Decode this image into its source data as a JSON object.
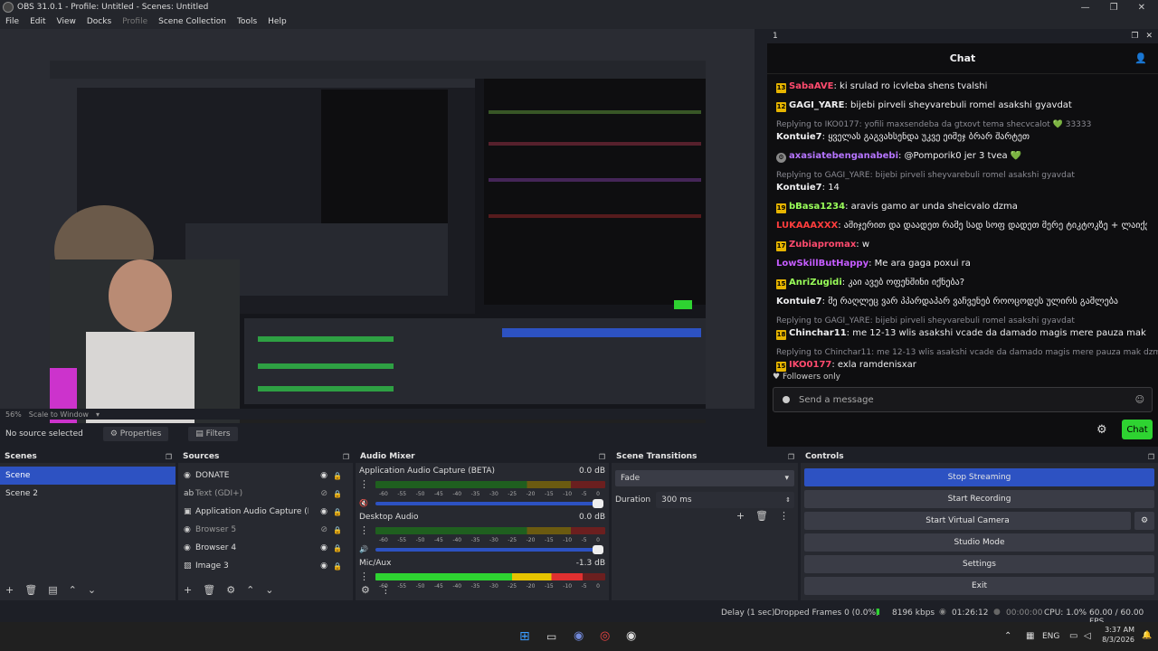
{
  "window": {
    "title": "OBS 31.0.1 - Profile: Untitled - Scenes: Untitled",
    "min": "—",
    "max": "❐",
    "close": "✕"
  },
  "menu": [
    "File",
    "Edit",
    "View",
    "Docks",
    "Profile",
    "Scene Collection",
    "Tools",
    "Help"
  ],
  "preview": {
    "zoom": "56%",
    "scale_mode": "Scale to Window"
  },
  "source_bar": {
    "status": "No source selected",
    "properties": "Properties",
    "filters": "Filters"
  },
  "chat": {
    "dock_title": "1",
    "title": "Chat",
    "messages": [
      {
        "badge": "13",
        "name": "SabaAVE",
        "color": "#ff4b6e",
        "text": ": ki srulad ro icvleba shens tvalshi"
      },
      {
        "badge": "12",
        "name": "GAGI_YARE",
        "color": "#efeff1",
        "text": ": bijebi pirveli sheyvarebuli romel asakshi gyavdat"
      },
      {
        "reply": "Replying to IKO0177: yofili maxsendeba da gtxovt tema shecvcalot 💚 33333"
      },
      {
        "badge": "",
        "name": "Kontuie7",
        "color": "#efeff1",
        "text": ": ყველას გაგვახსენდა უკვე ეიმეჯ ბრარ შარტეთ"
      },
      {
        "badge": "⚙",
        "name": "axasiatebenganabebi",
        "color": "#b675ff",
        "text": ": @Pomporik0 jer 3 tvea 💚"
      },
      {
        "reply": "Replying to GAGI_YARE: bijebi pirveli sheyvarebuli romel asakshi gyavdat"
      },
      {
        "badge": "",
        "name": "Kontuie7",
        "color": "#efeff1",
        "text": ": 14"
      },
      {
        "badge": "19",
        "name": "bBasa1234",
        "color": "#9aff5a",
        "text": ": aravis gamo ar unda sheicvalo dzma"
      },
      {
        "badge": "",
        "name": "LUKAAAXXX",
        "color": "#ff3d3d",
        "text": ": ამიჯერით და დაადეთ რამე სად სოფ დადეთ მერე ტიკტოკზე + ლაიქები"
      },
      {
        "badge": "17",
        "name": "Zubiapromax",
        "color": "#ff4b6e",
        "text": ": w"
      },
      {
        "badge": "",
        "name": "LowSkillButHappy",
        "color": "#c55cff",
        "text": ": Me ara gaga poxui ra"
      },
      {
        "badge": "15",
        "name": "AnriZugidi",
        "color": "#9aff5a",
        "text": ": კაი ავებ ოფენშინი იქნება?"
      },
      {
        "badge": "",
        "name": "Kontuie7",
        "color": "#efeff1",
        "text": ": მე რაღლეც ვარ პპარდაპარ ვაჩვენებ როოცოდეს ულირს გამლება"
      },
      {
        "reply": "Replying to GAGI_YARE: bijebi pirveli sheyvarebuli romel asakshi gyavdat"
      },
      {
        "badge": "18",
        "name": "Chinchar11",
        "color": "#efeff1",
        "text": ": me 12-13 wlis asakshi vcade da damado magis mere pauza mak dzmao"
      },
      {
        "reply": "Replying to Chinchar11: me 12-13 wlis asakshi vcade da damado magis mere pauza mak dzmao"
      },
      {
        "badge": "15",
        "name": "IKO0177",
        "color": "#ff4b6e",
        "text": ": exla ramdenisxar"
      }
    ],
    "followers": "Followers only",
    "placeholder": "Send a message",
    "send": "Chat"
  },
  "scenes": {
    "title": "Scenes",
    "items": [
      "Scene",
      "Scene 2"
    ]
  },
  "sources": {
    "title": "Sources",
    "items": [
      {
        "label": "DONATE",
        "icon": "◉",
        "dim": false
      },
      {
        "label": "Text (GDI+)",
        "icon": "ab",
        "dim": true
      },
      {
        "label": "Application Audio Capture (BETA)",
        "icon": "▣",
        "dim": false
      },
      {
        "label": "Browser 5",
        "icon": "◉",
        "dim": true
      },
      {
        "label": "Browser 4",
        "icon": "◉",
        "dim": false
      },
      {
        "label": "Image 3",
        "icon": "▨",
        "dim": false
      }
    ]
  },
  "mixer": {
    "title": "Audio Mixer",
    "channels": [
      {
        "name": "Application Audio Capture (BETA)",
        "db": "0.0 dB",
        "level": 0
      },
      {
        "name": "Desktop Audio",
        "db": "0.0 dB",
        "level": 0
      },
      {
        "name": "Mic/Aux",
        "db": "-1.3 dB",
        "level": 0.9
      }
    ],
    "ticks": [
      "-60",
      "-55",
      "-50",
      "-45",
      "-40",
      "-35",
      "-30",
      "-25",
      "-20",
      "-15",
      "-10",
      "-5",
      "0"
    ]
  },
  "transitions": {
    "title": "Scene Transitions",
    "type": "Fade",
    "duration_label": "Duration",
    "duration": "300 ms"
  },
  "controls": {
    "title": "Controls",
    "buttons": [
      "Stop Streaming",
      "Start Recording",
      "Start Virtual Camera",
      "Studio Mode",
      "Settings",
      "Exit"
    ]
  },
  "status": {
    "delay": "Delay (1 sec)",
    "dropped": "Dropped Frames 0 (0.0%)",
    "kbps": "8196 kbps",
    "stream_time": "01:26:12",
    "rec_time": "00:00:00",
    "cpu": "CPU: 1.0%",
    "fps": "60.00 / 60.00 FPS"
  },
  "taskbar": {
    "lang": "ENG",
    "time": "3:37 AM",
    "date": "8/3/2026"
  }
}
